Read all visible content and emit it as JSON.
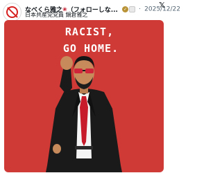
{
  "post": {
    "display_name": "なべくら雅之",
    "display_name_suffix": "（フォローしな...",
    "separator": "·",
    "date": "2025/12/22",
    "bio_line": "日本共産党党員 鍋倉雅之",
    "verified_mark": "✓",
    "platform_logo": "𝕏"
  },
  "media": {
    "caption_line1": "RACIST,",
    "caption_line2": "GO HOME."
  },
  "icons": [
    "avatar-no-sign-icon",
    "rose-icon",
    "verified-badge-icon",
    "government-badge-icon",
    "x-logo-icon"
  ],
  "colors": {
    "media_background": "#cf3a37",
    "caption_text": "#ffffff",
    "suit": "#1a1a1a",
    "tie": "#c71a2a",
    "verified_gold": "#b89235"
  }
}
